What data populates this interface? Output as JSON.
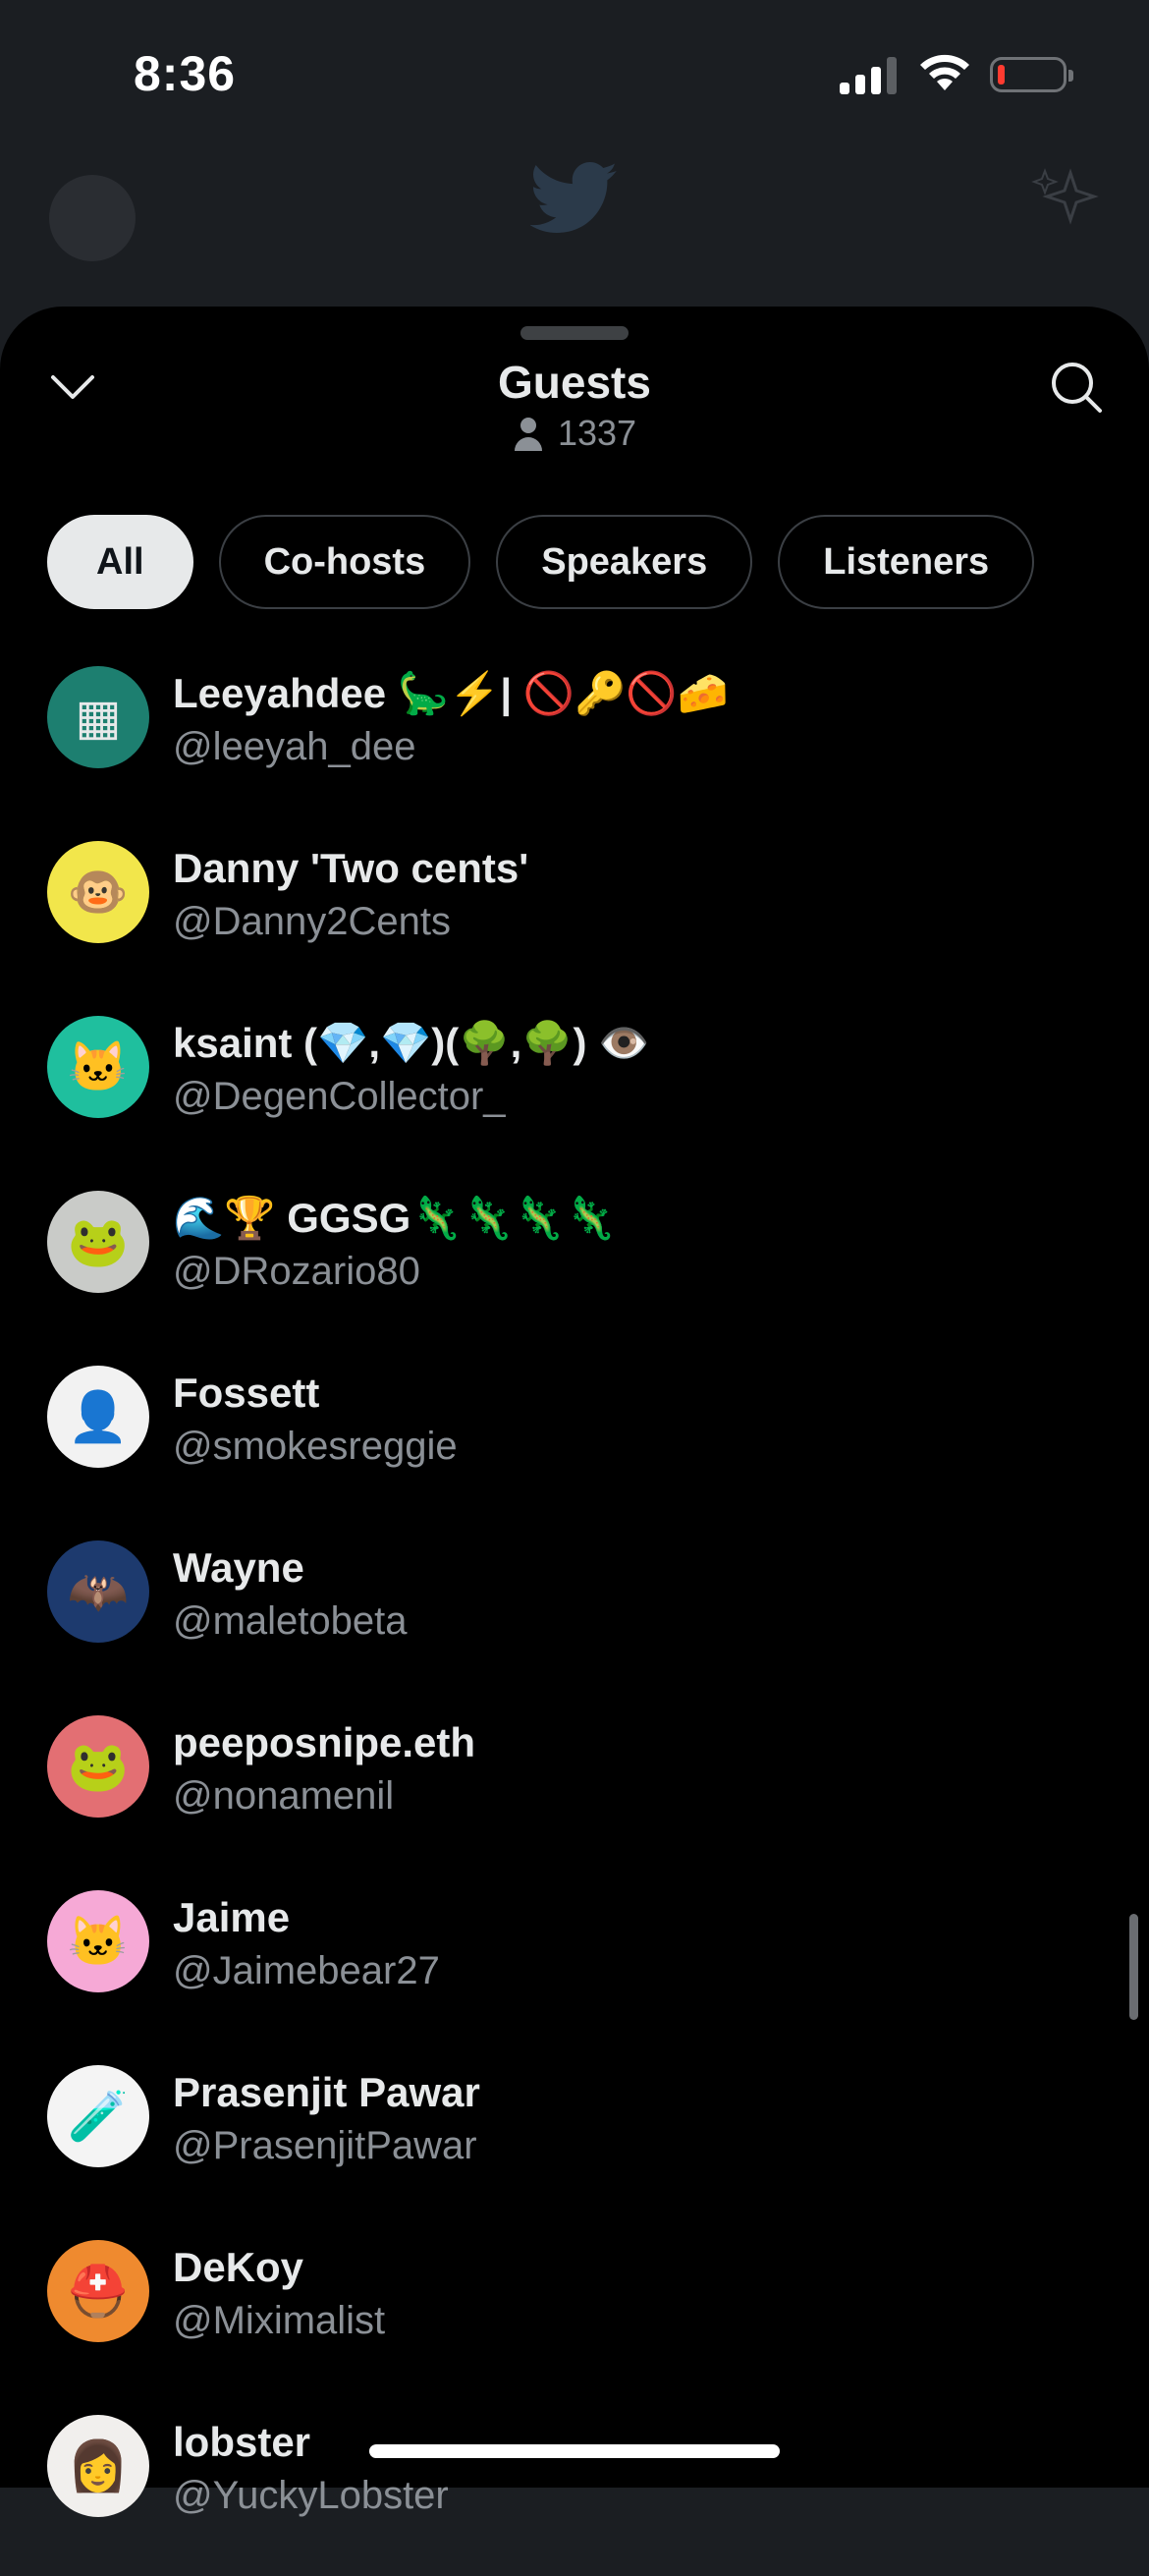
{
  "status_bar": {
    "time": "8:36"
  },
  "sheet": {
    "title": "Guests",
    "count": "1337"
  },
  "tabs": [
    {
      "label": "All",
      "active": true
    },
    {
      "label": "Co-hosts",
      "active": false
    },
    {
      "label": "Speakers",
      "active": false
    },
    {
      "label": "Listeners",
      "active": false
    }
  ],
  "guests": [
    {
      "name": "Leeyahdee 🦕⚡| 🚫🔑🚫🧀",
      "handle": "@leeyah_dee",
      "avatar_color": "#1d7f70",
      "avatar_glyph": "▦"
    },
    {
      "name": "Danny 'Two cents'",
      "handle": "@Danny2Cents",
      "avatar_color": "#f2e64b",
      "avatar_glyph": "🐵"
    },
    {
      "name": "ksaint (💎,💎)(🌳,🌳) 👁️",
      "handle": "@DegenCollector_",
      "avatar_color": "#1fbf9e",
      "avatar_glyph": "🐱"
    },
    {
      "name": "🌊🏆 GGSG🦎🦎🦎🦎",
      "handle": "@DRozario80",
      "avatar_color": "#c9cbc8",
      "avatar_glyph": "🐸"
    },
    {
      "name": "Fossett",
      "handle": "@smokesreggie",
      "avatar_color": "#f2f2f2",
      "avatar_glyph": "👤"
    },
    {
      "name": "Wayne",
      "handle": "@maletobeta",
      "avatar_color": "#1d3a6e",
      "avatar_glyph": "🦇"
    },
    {
      "name": "peeposnipe.eth",
      "handle": "@nonamenil",
      "avatar_color": "#e36f73",
      "avatar_glyph": "🐸"
    },
    {
      "name": "Jaime",
      "handle": "@Jaimebear27",
      "avatar_color": "#f6a9d6",
      "avatar_glyph": "🐱"
    },
    {
      "name": "Prasenjit Pawar",
      "handle": "@PrasenjitPawar",
      "avatar_color": "#f4f4f4",
      "avatar_glyph": "🧪"
    },
    {
      "name": "DeKoy",
      "handle": "@Miximalist",
      "avatar_color": "#ef8a2f",
      "avatar_glyph": "⛑️"
    },
    {
      "name": "lobster",
      "handle": "@YuckyLobster",
      "avatar_color": "#f1efed",
      "avatar_glyph": "👩"
    }
  ],
  "icons": {
    "collapse": "chevron-down-icon",
    "search": "search-icon",
    "count": "person-icon"
  }
}
